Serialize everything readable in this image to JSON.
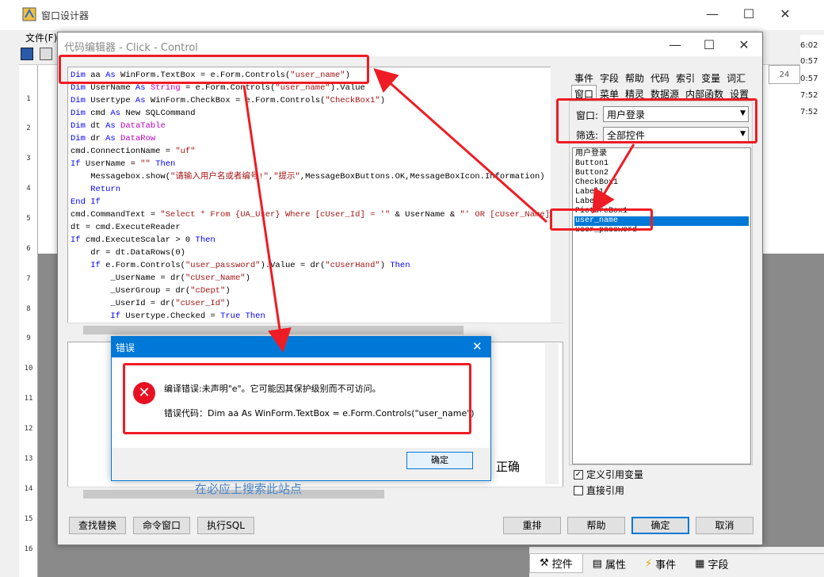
{
  "outer": {
    "title": "窗口设计器",
    "menu_file": "文件(F)",
    "ruler_numbers": [
      "1",
      "2",
      "3",
      "4",
      "5",
      "6",
      "7",
      "8",
      "9",
      "10",
      "11",
      "12",
      "13",
      "14",
      "15",
      "16"
    ],
    "right_times": [
      "6:02",
      "0:57",
      "0:57",
      "7:52",
      "7:52"
    ],
    "right_ruler_label": "24",
    "peek_label": "正确",
    "peek_label2": "在必应上搜索此站点",
    "bottom_tabs": [
      {
        "label": "控件",
        "icon": "tools-icon"
      },
      {
        "label": "属性",
        "icon": "properties-icon"
      },
      {
        "label": "事件",
        "icon": "lightning-icon"
      },
      {
        "label": "字段",
        "icon": "fields-icon"
      }
    ]
  },
  "editor": {
    "title": "代码编辑器 - Click - Control",
    "code_lines": [
      "Dim aa As WinForm.TextBox = e.Form.Controls(\"user_name\")",
      "Dim UserName As String = e.Form.Controls(\"user_name\").Value",
      "Dim Usertype As WinForm.CheckBox = e.Form.Controls(\"CheckBox1\")",
      "Dim cmd As New SQLCommand",
      "Dim dt As DataTable",
      "Dim dr As DataRow",
      "cmd.ConnectionName = \"uf\"",
      "If UserName = \"\" Then",
      "    Messagebox.show(\"请输入用户名或者编号!\",\"提示\",MessageBoxButtons.OK,MessageBoxIcon.Information)",
      "    Return",
      "End If",
      "cmd.CommandText = \"Select * From {UA_User} Where [cUser_Id] = '\" & UserName & \"' OR [cUser_Name] = '\"",
      "dt = cmd.ExecuteReader",
      "If cmd.ExecuteScalar > 0 Then",
      "    dr = dt.DataRows(0)",
      "    If e.Form.Controls(\"user_password\").Value = dr(\"cUserHand\") Then",
      "        _UserName = dr(\"cUser_Name\")",
      "        _UserGroup = dr(\"cDept\")",
      "        _UserId = dr(\"cUser_Id\")",
      "        If Usertype.Checked = True Then"
    ],
    "buttons": {
      "find_replace": "查找替换",
      "command_window": "命令窗口",
      "run_sql": "执行SQL",
      "rearrange": "重排",
      "help": "帮助",
      "ok": "确定",
      "cancel": "取消"
    }
  },
  "right_panel": {
    "tabs_row1": [
      "事件",
      "字段",
      "帮助",
      "代码",
      "索引",
      "变量",
      "词汇"
    ],
    "tabs_row2": [
      "窗口",
      "菜单",
      "精灵",
      "数据源",
      "内部函数",
      "设置"
    ],
    "window_label": "窗口:",
    "window_value": "用户登录",
    "filter_label": "筛选:",
    "filter_value": "全部控件",
    "controls": [
      "用户登录",
      "Button1",
      "Button2",
      "CheckBox1",
      "Label1",
      "Label2",
      "PictureBox1",
      "user_name",
      "user_password"
    ],
    "selected_control": "user_name",
    "check_define_ref": "定义引用变量",
    "check_direct_ref": "直接引用"
  },
  "error_dialog": {
    "title": "错误",
    "message": "编译错误:未声明\"e\"。它可能因其保护级别而不可访问。",
    "code_line": "错误代码：Dim aa As WinForm.TextBox = e.Form.Controls(\"user_name\")",
    "ok": "确定"
  },
  "colors": {
    "annotation": "#ee1c24",
    "accent": "#0078d7",
    "keyword": "#0000ff",
    "string": "#a31515"
  }
}
